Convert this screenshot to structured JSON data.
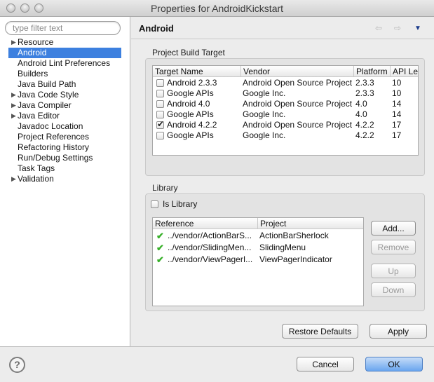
{
  "window": {
    "title": "Properties for AndroidKickstart"
  },
  "sidebar": {
    "filter_placeholder": "type filter text",
    "items": [
      {
        "label": "Resource",
        "expandable": true
      },
      {
        "label": "Android",
        "expandable": false,
        "selected": true
      },
      {
        "label": "Android Lint Preferences",
        "expandable": false
      },
      {
        "label": "Builders",
        "expandable": false
      },
      {
        "label": "Java Build Path",
        "expandable": false
      },
      {
        "label": "Java Code Style",
        "expandable": true
      },
      {
        "label": "Java Compiler",
        "expandable": true
      },
      {
        "label": "Java Editor",
        "expandable": true
      },
      {
        "label": "Javadoc Location",
        "expandable": false
      },
      {
        "label": "Project References",
        "expandable": false
      },
      {
        "label": "Refactoring History",
        "expandable": false
      },
      {
        "label": "Run/Debug Settings",
        "expandable": false
      },
      {
        "label": "Task Tags",
        "expandable": false
      },
      {
        "label": "Validation",
        "expandable": true
      }
    ]
  },
  "page": {
    "title": "Android"
  },
  "build_target": {
    "group_label": "Project Build Target",
    "columns": [
      "Target Name",
      "Vendor",
      "Platform",
      "API Le"
    ],
    "rows": [
      {
        "name": "Android 2.3.3",
        "vendor": "Android Open Source Project",
        "platform": "2.3.3",
        "api": "10",
        "checked": false
      },
      {
        "name": "Google APIs",
        "vendor": "Google Inc.",
        "platform": "2.3.3",
        "api": "10",
        "checked": false
      },
      {
        "name": "Android 4.0",
        "vendor": "Android Open Source Project",
        "platform": "4.0",
        "api": "14",
        "checked": false
      },
      {
        "name": "Google APIs",
        "vendor": "Google Inc.",
        "platform": "4.0",
        "api": "14",
        "checked": false
      },
      {
        "name": "Android 4.2.2",
        "vendor": "Android Open Source Project",
        "platform": "4.2.2",
        "api": "17",
        "checked": true
      },
      {
        "name": "Google APIs",
        "vendor": "Google Inc.",
        "platform": "4.2.2",
        "api": "17",
        "checked": false
      }
    ]
  },
  "library": {
    "group_label": "Library",
    "is_library_label": "Is Library",
    "is_library_checked": false,
    "columns": [
      "Reference",
      "Project"
    ],
    "rows": [
      {
        "reference": "../vendor/ActionBarS...",
        "project": "ActionBarSherlock"
      },
      {
        "reference": "../vendor/SlidingMen...",
        "project": "SlidingMenu"
      },
      {
        "reference": "../vendor/ViewPagerI...",
        "project": "ViewPagerIndicator"
      }
    ],
    "buttons": {
      "add": "Add...",
      "remove": "Remove",
      "up": "Up",
      "down": "Down"
    }
  },
  "actions": {
    "restore_defaults": "Restore Defaults",
    "apply": "Apply",
    "cancel": "Cancel",
    "ok": "OK"
  },
  "help": {
    "glyph": "?"
  },
  "icons": {
    "nav_back": "⇦",
    "nav_forward": "⇨",
    "nav_menu": "▼",
    "expand": "▶",
    "lib_ok": "✔"
  }
}
